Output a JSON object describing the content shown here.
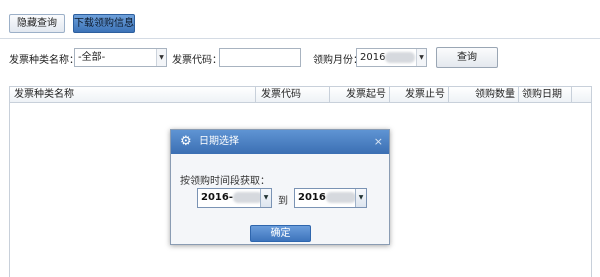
{
  "top_buttons": {
    "hidden_query": "隐藏查询",
    "download_purchase": "下载领购信息"
  },
  "filters": {
    "invoice_type_label": "发票种类名称：",
    "invoice_type_value": "-全部-",
    "invoice_code_label": "发票代码：",
    "invoice_code_value": "",
    "purchase_month_label": "领购月份：",
    "purchase_month_value": "2016",
    "query_button": "查询"
  },
  "table": {
    "columns": [
      "发票种类名称",
      "发票代码",
      "发票起号",
      "发票止号",
      "领购数量",
      "领购日期"
    ],
    "rows": []
  },
  "dialog": {
    "title": "日期选择",
    "prompt": "按领购时间段获取：",
    "start_date": "2016-",
    "to_label": "到",
    "end_date": "2016",
    "confirm_button": "确定",
    "close_glyph": "×",
    "icon": "gear-icon"
  },
  "colors": {
    "accent": "#3d74bc",
    "header_gradient_top": "#5f94d3",
    "header_gradient_bottom": "#3b6fb3"
  }
}
